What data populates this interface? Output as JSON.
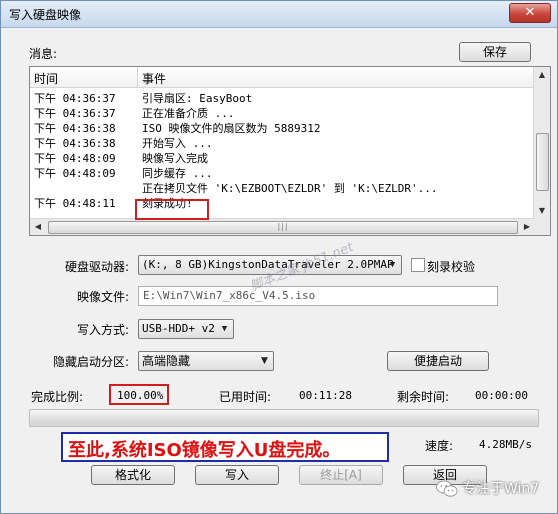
{
  "window": {
    "title": "写入硬盘映像",
    "close_glyph": "✕"
  },
  "messages": {
    "label": "消息:",
    "save_button": "保存",
    "columns": {
      "time": "时间",
      "event": "事件"
    },
    "rows": [
      {
        "time": "下午 04:36:37",
        "event": "引导扇区: EasyBoot"
      },
      {
        "time": "下午 04:36:37",
        "event": "正在准备介质 ..."
      },
      {
        "time": "下午 04:36:38",
        "event": "ISO 映像文件的扇区数为 5889312"
      },
      {
        "time": "下午 04:36:38",
        "event": "开始写入 ..."
      },
      {
        "time": "下午 04:48:09",
        "event": "映像写入完成"
      },
      {
        "time": "下午 04:48:09",
        "event": "同步缓存 ..."
      },
      {
        "time": "",
        "event": "正在拷贝文件 'K:\\EZBOOT\\EZLDR' 到 'K:\\EZLDR'..."
      },
      {
        "time": "下午 04:48:11",
        "event": "刻录成功!"
      }
    ]
  },
  "drive": {
    "label": "硬盘驱动器:",
    "value": "(K:, 8 GB)KingstonDataTraveler 2.0PMAP",
    "verify_label": "刻录校验",
    "verify_checked": false
  },
  "image_file": {
    "label": "映像文件:",
    "value": "E:\\Win7\\Win7_x86c_V4.5.iso"
  },
  "write_mode": {
    "label": "写入方式:",
    "value": "USB-HDD+ v2"
  },
  "hidden_partition": {
    "label": "隐藏启动分区:",
    "value": "高端隐藏",
    "quick_boot_button": "便捷启动"
  },
  "status": {
    "completion_label": "完成比例:",
    "completion_value": "100.00%",
    "completion_fraction": 1.0,
    "elapsed_label": "已用时间:",
    "elapsed_value": "00:11:28",
    "remaining_label": "剩余时间:",
    "remaining_value": "00:00:00",
    "speed_label": "速度:",
    "speed_value": "4.28MB/s"
  },
  "annotation": {
    "text": "至此,系统ISO镜像写入U盘完成。"
  },
  "buttons": {
    "format": "格式化",
    "write": "写入",
    "stop": "终止[A]",
    "back": "返回"
  },
  "watermarks": {
    "diagonal": "脚本之家 jb51.net",
    "wechat": "专注于Win7"
  },
  "colors": {
    "highlight_red": "#cc1f1f",
    "annotation_text": "#e01010",
    "annotation_border": "#1e2ca8"
  }
}
